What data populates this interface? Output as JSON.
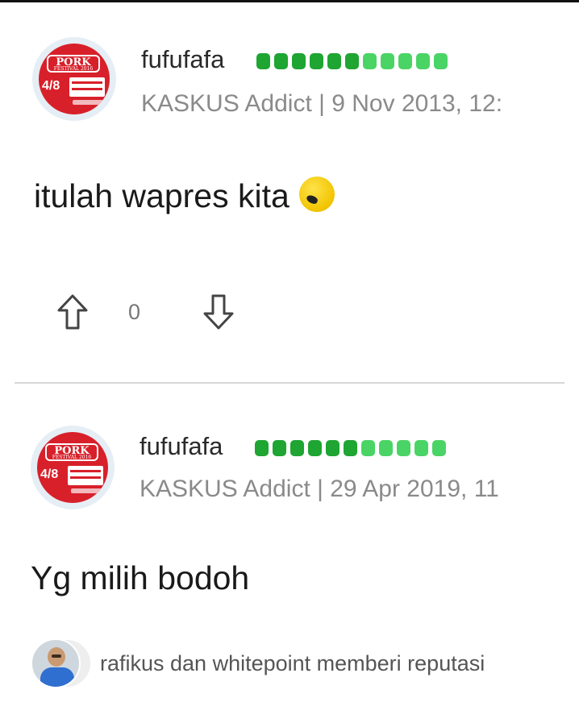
{
  "posts": [
    {
      "username": "fufufafa",
      "meta": "KASKUS Addict | 9 Nov 2013, 12:",
      "content": "itulah wapres kita",
      "avatar": {
        "badge_title": "PORK",
        "badge_sub": "FESTIVAL 2016",
        "badge_date": "4/8"
      },
      "rep_pips": 11,
      "votes": {
        "count": "0"
      }
    },
    {
      "username": "fufufafa",
      "meta": "KASKUS Addict | 29 Apr 2019, 11",
      "content": "Yg milih bodoh",
      "avatar": {
        "badge_title": "PORK",
        "badge_sub": "FESTIVAL 2016",
        "badge_date": "4/8"
      },
      "rep_pips": 11,
      "reputation_text": "rafikus dan whitepoint memberi reputasi"
    }
  ],
  "colors": {
    "rep_dark": "#1fa532",
    "rep_light": "#4ad465",
    "meta_gray": "#8a8a8a",
    "divider": "#d6d6d6"
  },
  "icons": {
    "upvote": "arrow-up-outline-icon",
    "downvote": "arrow-down-outline-icon",
    "emoji": "yellow-face-emoji"
  }
}
